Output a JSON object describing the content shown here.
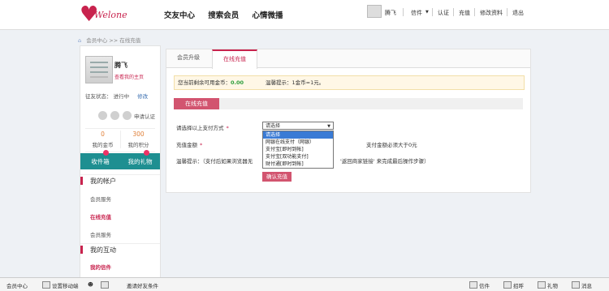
{
  "header": {
    "logo_text": "Welone",
    "nav": [
      "交友中心",
      "搜索会员",
      "心情微播"
    ],
    "top_links": [
      "腾飞",
      "信件",
      "认证",
      "充值",
      "修改资料",
      "退出"
    ]
  },
  "breadcrumb": {
    "root": "会员中心",
    "sep": ">>",
    "current": "在线充值"
  },
  "sidebar": {
    "username": "腾飞",
    "profile_link": "查看我的主页",
    "status_label": "征友状态：",
    "status_value": "进行中",
    "status_edit": "修改",
    "verify_label": "申请认证",
    "coins": {
      "value": "0",
      "label": "我的金币"
    },
    "points": {
      "value": "300",
      "label": "我的积分"
    },
    "mailbox": "收件箱",
    "gifts": "我的礼物",
    "account_head": "我的帐户",
    "account_items": [
      "会员服务",
      "在线充值",
      "会员服务"
    ],
    "interact_head": "我的互动",
    "interact_items": [
      "我的信件"
    ]
  },
  "main": {
    "tabs": [
      "会员升级",
      "在线充值"
    ],
    "balance_label": "您当前剩余可用金币：",
    "balance_value": "0.00",
    "tip_label": "温馨提示：",
    "tip_rate": "1金币=1元。",
    "section_title": "在线充值",
    "pay_method_label": "请选择以上支付方式",
    "amount_label": "充值金额",
    "note_label": "温馨提示：（支付后如果浏览器无",
    "select_value": "请选择",
    "options": [
      "请选择",
      "网银在线支付（网银）",
      "支付宝[即时到帐]",
      "支付宝[双功能支付]",
      "财付通[即时到帐]"
    ],
    "amount_hint": "支付金额必须大于0元",
    "note_tail": "'返回商家链接' 来完成最后操作步骤）",
    "confirm": "确认充值"
  },
  "footer": {
    "items": [
      "会员中心",
      "设置移动端",
      "邀请好友条件"
    ],
    "right_items": [
      "信件",
      "招呼",
      "礼物",
      "消息"
    ]
  }
}
